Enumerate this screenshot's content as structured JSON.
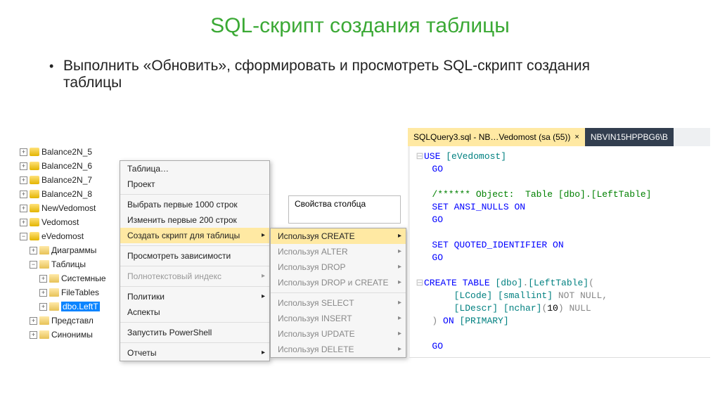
{
  "title": "SQL-скрипт создания таблицы",
  "bullet": "Выполнить «Обновить», сформировать и просмотреть SQL-скрипт создания таблицы",
  "tree": {
    "Balance2N_5": "Balance2N_5",
    "Balance2N_6": "Balance2N_6",
    "Balance2N_7": "Balance2N_7",
    "Balance2N_8": "Balance2N_8",
    "NewVedomost": "NewVedomost",
    "Vedomost": "Vedomost",
    "eVedomost": "eVedomost",
    "Diagrams": "Диаграммы",
    "Tables": "Таблицы",
    "System": "Системные",
    "FileTables": "FileTables",
    "LeftTable": "dbo.LeftT",
    "Views": "Представл",
    "Synonyms": "Синонимы"
  },
  "menu1": {
    "Table": "Таблица…",
    "Project": "Проект",
    "Select1000": "Выбрать первые 1000 строк",
    "Edit200": "Изменить первые 200 строк",
    "ScriptTable": "Создать скрипт для таблицы",
    "ViewDeps": "Просмотреть зависимости",
    "FullText": "Полнотекстовый индекс",
    "Policies": "Политики",
    "Aspects": "Аспекты",
    "PowerShell": "Запустить PowerShell",
    "Reports": "Отчеты"
  },
  "menu2": {
    "CREATE": "Используя CREATE",
    "ALTER": "Используя ALTER",
    "DROP": "Используя DROP",
    "DROPCREATE": "Используя DROP и CREATE",
    "SELECT": "Используя SELECT",
    "INSERT": "Используя INSERT",
    "UPDATE": "Используя UPDATE",
    "DELETE": "Используя DELETE"
  },
  "propbox": "Свойства столбца",
  "tabs": {
    "active": "SQLQuery3.sql - NB…Vedomost (sa (55))",
    "close": "×",
    "other": "NBVIN15HPPBG6\\В"
  },
  "sql": {
    "use": "USE ",
    "db": "[eVedomost]",
    "go": "GO",
    "comment": "/****** Object:  Table [dbo].[LeftTable]",
    "set_ansi": "SET ANSI_NULLS ",
    "on": "ON",
    "set_quoted": "SET QUOTED_IDENTIFIER ",
    "create": "CREATE TABLE ",
    "tbl": "[dbo]",
    "dot": ".",
    "tbl2": "[LeftTable]",
    "paren1": "(",
    "col1a": "[LCode] [smallint] ",
    "notnull": "NOT NULL",
    "comma": ",",
    "col2a": "[LDescr] [nchar]",
    "col2b": "(",
    "ten": "10",
    "col2c": ") ",
    "null": "NULL",
    "paren2": ")",
    "onkw": " ON ",
    "primary": "[PRIMARY]"
  }
}
